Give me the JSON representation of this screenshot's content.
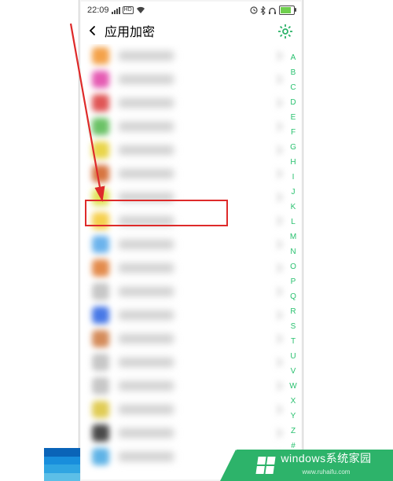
{
  "status": {
    "time": "22:09",
    "hd_label": "HD"
  },
  "header": {
    "title": "应用加密"
  },
  "index_letters": [
    "A",
    "B",
    "C",
    "D",
    "E",
    "F",
    "G",
    "H",
    "I",
    "J",
    "K",
    "L",
    "M",
    "N",
    "O",
    "P",
    "Q",
    "R",
    "S",
    "T",
    "U",
    "V",
    "W",
    "X",
    "Y",
    "Z",
    "#"
  ],
  "rows": [
    {
      "color": "#f4a24a"
    },
    {
      "color": "#e55bb3"
    },
    {
      "color": "#e05656"
    },
    {
      "color": "#6bc266"
    },
    {
      "color": "#e9d54a"
    },
    {
      "color": "#d77540"
    },
    {
      "color": "#e2e25a"
    },
    {
      "color": "#f6d04e"
    },
    {
      "color": "#6bb3ec"
    },
    {
      "color": "#e38b4c"
    },
    {
      "color": "#c7c7c7"
    },
    {
      "color": "#4878e6"
    },
    {
      "color": "#d48b5a"
    },
    {
      "color": "#c7c7c7"
    },
    {
      "color": "#c7c7c7"
    },
    {
      "color": "#e0cc55"
    },
    {
      "color": "#4a4a4a"
    },
    {
      "color": "#5fb3e6"
    }
  ],
  "highlight_row_index": 7,
  "watermark": {
    "main": "windows系统家园",
    "sub": "www.ruhaifu.com"
  }
}
